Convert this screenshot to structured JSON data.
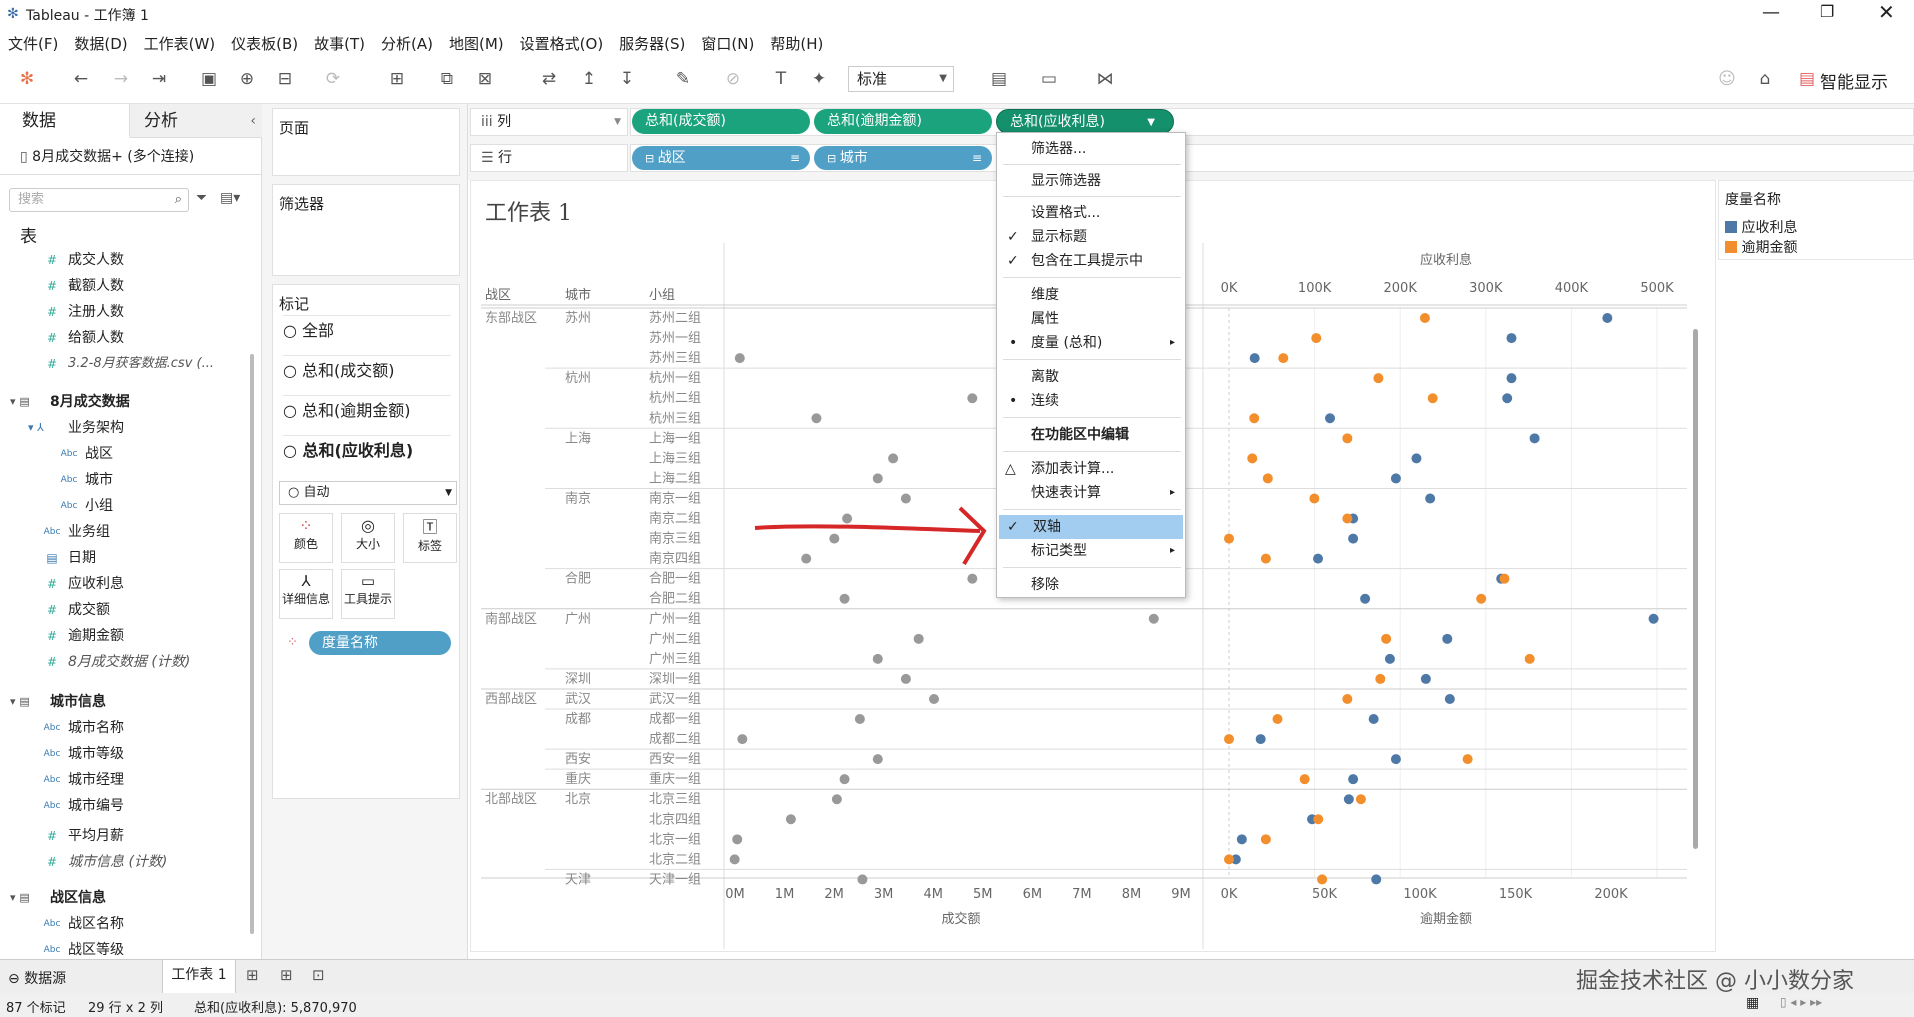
{
  "window": {
    "title": "Tableau - 工作簿 1"
  },
  "menu": [
    "文件(F)",
    "数据(D)",
    "工作表(W)",
    "仪表板(B)",
    "故事(T)",
    "分析(A)",
    "地图(M)",
    "设置格式(O)",
    "服务器(S)",
    "窗口(N)",
    "帮助(H)"
  ],
  "toolbar": {
    "fit_value": "标准",
    "smart_show": "智能显示"
  },
  "left": {
    "tab_data": "数据",
    "tab_analysis": "分析",
    "datasource": "8月成交数据+ (多个连接)",
    "search_placeholder": "搜索",
    "section_table": "表",
    "fields_a": [
      "成交人数",
      "截额人数",
      "注册人数",
      "给额人数"
    ],
    "csv_count": "3.2-8月获客数据.csv (...",
    "group1": "8月成交数据",
    "hierarchy": "业务架构",
    "hier_items": [
      "战区",
      "城市",
      "小组"
    ],
    "group1_items": [
      "业务组",
      "日期"
    ],
    "measures1": [
      "应收利息",
      "成交额",
      "逾期金额"
    ],
    "count1": "8月成交数据 (计数)",
    "group2": "城市信息",
    "group2_items": [
      "城市名称",
      "城市等级",
      "城市经理",
      "城市编号"
    ],
    "avg_salary": "平均月薪",
    "count2": "城市信息 (计数)",
    "group3": "战区信息",
    "group3_items": [
      "战区名称",
      "战区等级"
    ]
  },
  "mid": {
    "pages": "页面",
    "filters": "筛选器",
    "marks": "标记",
    "mark_rows": [
      "全部",
      "总和(成交额)",
      "总和(逾期金额)",
      "总和(应收利息)"
    ],
    "mark_type": "自动",
    "cards": [
      "颜色",
      "大小",
      "标签",
      "详细信息",
      "工具提示"
    ],
    "measure_names": "度量名称"
  },
  "shelves": {
    "columns_label": "列",
    "rows_label": "行",
    "columns": [
      "总和(成交额)",
      "总和(逾期金额)",
      "总和(应收利息)"
    ],
    "rows": [
      "战区",
      "城市"
    ]
  },
  "view": {
    "sheet_title": "工作表 1",
    "header_region": "战区",
    "header_city": "城市",
    "header_group": "小组",
    "top_axis_title": "应收利息",
    "top_ticks": [
      "0K",
      "100K",
      "200K",
      "300K",
      "400K",
      "500K"
    ],
    "bottom_ticks_left": [
      "0M",
      "1M",
      "2M",
      "3M",
      "4M",
      "5M",
      "6M",
      "7M",
      "8M",
      "9M"
    ],
    "bottom_ticks_right": [
      "0K",
      "50K",
      "100K",
      "150K",
      "200K"
    ],
    "bottom_title_left": "成交额",
    "bottom_title_right": "逾期金额"
  },
  "rows_data": [
    {
      "region": "东部战区",
      "city": "苏州",
      "group": "苏州二组",
      "deal": null,
      "overdue": 101,
      "interest": 442
    },
    {
      "region": "",
      "city": "",
      "group": "苏州一组",
      "deal": null,
      "overdue": 45,
      "interest": 330
    },
    {
      "region": "",
      "city": "",
      "group": "苏州三组",
      "deal": 0.25,
      "overdue": 28,
      "interest": 30
    },
    {
      "region": "",
      "city": "杭州",
      "group": "杭州一组",
      "deal": null,
      "overdue": 77,
      "interest": 330
    },
    {
      "region": "",
      "city": "",
      "group": "杭州二组",
      "deal": 4.8,
      "overdue": 105,
      "interest": 325
    },
    {
      "region": "",
      "city": "",
      "group": "杭州三组",
      "deal": 1.75,
      "overdue": 13,
      "interest": 118
    },
    {
      "region": "",
      "city": "上海",
      "group": "上海一组",
      "deal": null,
      "overdue": 61,
      "interest": 357
    },
    {
      "region": "",
      "city": "",
      "group": "上海三组",
      "deal": 3.25,
      "overdue": 12,
      "interest": 219
    },
    {
      "region": "",
      "city": "",
      "group": "上海二组",
      "deal": 2.95,
      "overdue": 20,
      "interest": 195
    },
    {
      "region": "",
      "city": "南京",
      "group": "南京一组",
      "deal": 3.5,
      "overdue": 44,
      "interest": 235
    },
    {
      "region": "",
      "city": "",
      "group": "南京二组",
      "deal": 2.35,
      "overdue": 61,
      "interest": 145
    },
    {
      "region": "",
      "city": "",
      "group": "南京三组",
      "deal": 2.1,
      "overdue": 0,
      "interest": 145
    },
    {
      "region": "",
      "city": "",
      "group": "南京四组",
      "deal": 1.55,
      "overdue": 19,
      "interest": 104
    },
    {
      "region": "",
      "city": "合肥",
      "group": "合肥一组",
      "deal": 4.8,
      "overdue": 142,
      "interest": 318
    },
    {
      "region": "",
      "city": "",
      "group": "合肥二组",
      "deal": 2.3,
      "overdue": 130,
      "interest": 159
    },
    {
      "region": "南部战区",
      "city": "广州",
      "group": "广州一组",
      "deal": 8.35,
      "overdue": null,
      "interest": 496
    },
    {
      "region": "",
      "city": "",
      "group": "广州二组",
      "deal": 3.75,
      "overdue": 81,
      "interest": 255
    },
    {
      "region": "",
      "city": "",
      "group": "广州三组",
      "deal": 2.95,
      "overdue": 155,
      "interest": 188
    },
    {
      "region": "",
      "city": "深圳",
      "group": "深圳一组",
      "deal": 3.5,
      "overdue": 78,
      "interest": 230
    },
    {
      "region": "西部战区",
      "city": "武汉",
      "group": "武汉一组",
      "deal": 4.05,
      "overdue": 61,
      "interest": 258
    },
    {
      "region": "",
      "city": "成都",
      "group": "成都一组",
      "deal": 2.6,
      "overdue": 25,
      "interest": 169
    },
    {
      "region": "",
      "city": "",
      "group": "成都二组",
      "deal": 0.3,
      "overdue": 0,
      "interest": 37
    },
    {
      "region": "",
      "city": "西安",
      "group": "西安一组",
      "deal": 2.95,
      "overdue": 123,
      "interest": 195
    },
    {
      "region": "",
      "city": "重庆",
      "group": "重庆一组",
      "deal": 2.3,
      "overdue": 39,
      "interest": 145
    },
    {
      "region": "北部战区",
      "city": "北京",
      "group": "北京三组",
      "deal": 2.15,
      "overdue": 68,
      "interest": 140
    },
    {
      "region": "",
      "city": "",
      "group": "北京四组",
      "deal": 1.25,
      "overdue": 46,
      "interest": 97
    },
    {
      "region": "",
      "city": "",
      "group": "北京一组",
      "deal": 0.2,
      "overdue": 19,
      "interest": 15
    },
    {
      "region": "",
      "city": "",
      "group": "北京二组",
      "deal": 0.15,
      "overdue": 0,
      "interest": 8
    },
    {
      "region": "",
      "city": "天津",
      "group": "天津一组",
      "deal": 2.65,
      "overdue": 48,
      "interest": 172
    }
  ],
  "context_menu": {
    "items": [
      "筛选器...",
      "显示筛选器",
      "设置格式...",
      "显示标题",
      "包含在工具提示中",
      "维度",
      "属性",
      "度量 (总和)",
      "离散",
      "连续",
      "在功能区中编辑",
      "添加表计算...",
      "快速表计算",
      "双轴",
      "标记类型",
      "移除"
    ]
  },
  "legend": {
    "title": "度量名称",
    "items": [
      "应收利息",
      "逾期金额"
    ]
  },
  "colors": {
    "interest": "#4e79a7",
    "overdue": "#f28e2b",
    "deal": "#999999",
    "pill_measure": "#1aa37c",
    "pill_dim": "#4f9fc7",
    "highlight": "#a3cdf0",
    "arrow": "#d62728"
  },
  "bottom": {
    "datasource_tab": "数据源",
    "sheet_tab": "工作表 1"
  },
  "status": {
    "marks": "87 个标记",
    "dims": "29 行 x 2 列",
    "sum": "总和(应收利息): 5,870,970"
  },
  "watermark": "掘金技术社区 @ 小小数分家"
}
